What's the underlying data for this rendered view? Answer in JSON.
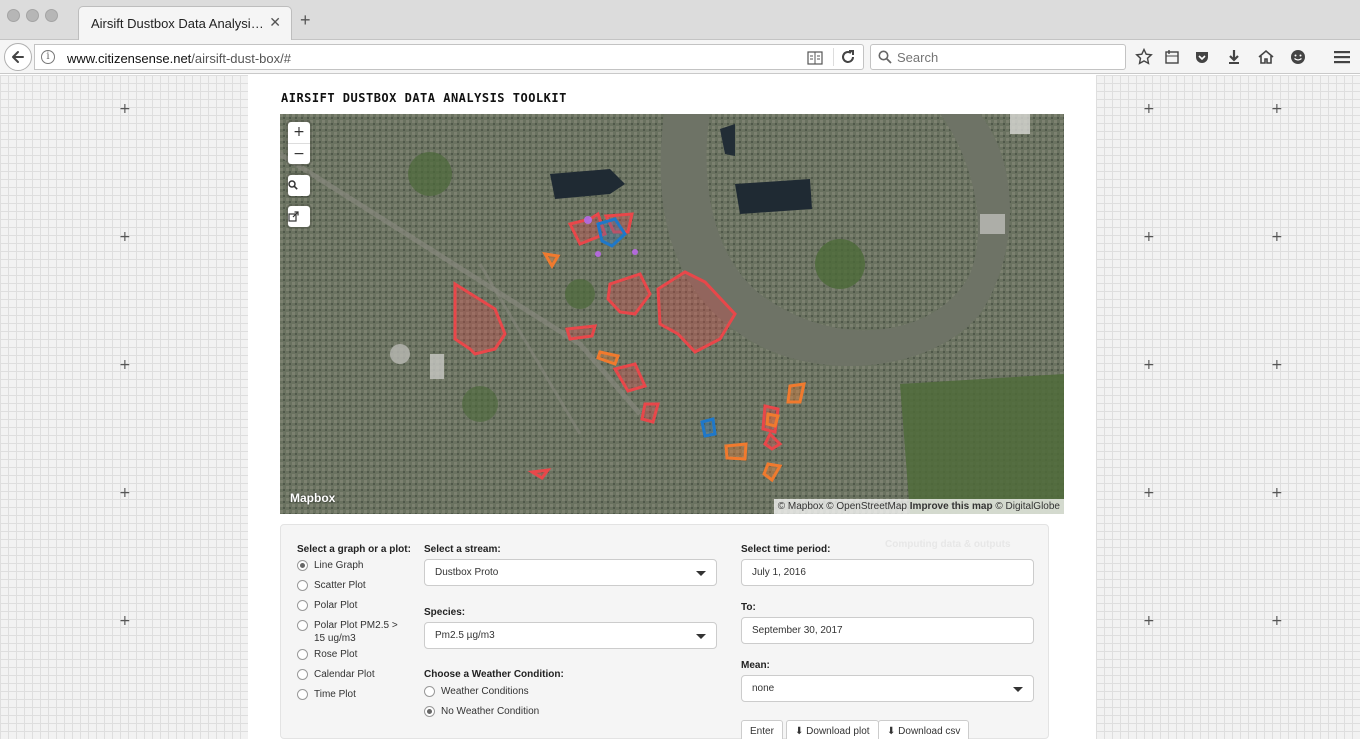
{
  "browser": {
    "tab_title": "Airsift Dustbox Data Analysis To…",
    "url_domain": "www.citizensense.net",
    "url_path": "/airsift-dust-box/#",
    "search_placeholder": "Search"
  },
  "page": {
    "title": "AIRSIFT DUSTBOX DATA ANALYSIS TOOLKIT"
  },
  "map": {
    "zoom_in": "+",
    "zoom_out": "−",
    "logo": "Mapbox",
    "attribution_prefix": "© Mapbox © OpenStreetMap ",
    "attribution_link": "Improve this map",
    "attribution_suffix": " © DigitalGlobe",
    "zone_colors": {
      "red": "#e8474a",
      "blue": "#1f78c9",
      "orange": "#f07a2e",
      "purple": "#b26ad9"
    }
  },
  "controls": {
    "graph_label": "Select a graph or a plot:",
    "graph_options": [
      "Line Graph",
      "Scatter Plot",
      "Polar Plot",
      "Polar Plot PM2.5 > 15 ug/m3",
      "Rose Plot",
      "Calendar Plot",
      "Time Plot"
    ],
    "graph_selected": "Line Graph",
    "stream_label": "Select a stream:",
    "stream_value": "Dustbox Proto",
    "species_label": "Species:",
    "species_value": "Pm2.5 µg/m3",
    "weather_label": "Choose a Weather Condition:",
    "weather_options": [
      "Weather Conditions",
      "No Weather Condition"
    ],
    "weather_selected": "No Weather Condition",
    "period_label": "Select time period:",
    "period_from": "July 1, 2016",
    "to_label": "To:",
    "period_to": "September 30, 2017",
    "mean_label": "Mean:",
    "mean_value": "none",
    "enter_button": "Enter",
    "download_plot_button": "Download plot",
    "download_csv_button": "Download csv",
    "computing_text": "Computing data & outputs"
  }
}
